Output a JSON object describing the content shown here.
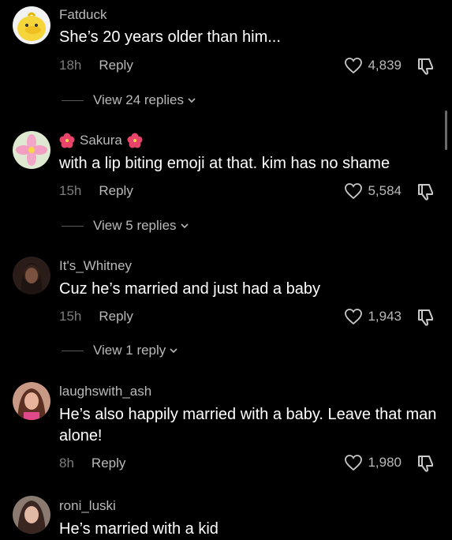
{
  "comments": [
    {
      "username": "Fatduck",
      "text": "She’s 20 years older than him...",
      "time": "18h",
      "reply": "Reply",
      "likes": "4,839",
      "view_replies": "View 24 replies"
    },
    {
      "username": "Sakura",
      "text": "with a lip biting emoji at that. kim has no shame",
      "time": "15h",
      "reply": "Reply",
      "likes": "5,584",
      "view_replies": "View 5 replies"
    },
    {
      "username": "It's_Whitney",
      "text": "Cuz he’s married and just had a baby",
      "time": "15h",
      "reply": "Reply",
      "likes": "1,943",
      "view_replies": "View 1 reply"
    },
    {
      "username": "laughswith_ash",
      "text": "He’s also happily married with a baby. Leave that man alone!",
      "time": "8h",
      "reply": "Reply",
      "likes": "1,980"
    },
    {
      "username": "roni_luski",
      "text": "He’s married with a kid"
    }
  ],
  "colors": {
    "background": "#000000",
    "secondary_text": "#b9b9b9",
    "time_text": "#7d7d7d"
  },
  "icons": {
    "like": "heart-outline-icon",
    "dislike": "thumbs-down-outline-icon",
    "flower": "hibiscus-emoji-icon"
  }
}
